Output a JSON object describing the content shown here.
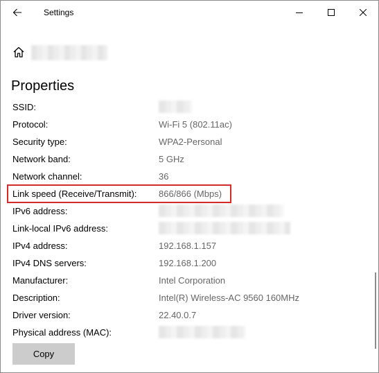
{
  "window": {
    "title": "Settings"
  },
  "page": {
    "heading": "Properties"
  },
  "properties": [
    {
      "label": "SSID:",
      "value": null
    },
    {
      "label": "Protocol:",
      "value": "Wi-Fi 5 (802.11ac)"
    },
    {
      "label": "Security type:",
      "value": "WPA2-Personal"
    },
    {
      "label": "Network band:",
      "value": "5 GHz"
    },
    {
      "label": "Network channel:",
      "value": "36"
    },
    {
      "label": "Link speed (Receive/Transmit):",
      "value": "866/866 (Mbps)"
    },
    {
      "label": "IPv6 address:",
      "value": null
    },
    {
      "label": "Link-local IPv6 address:",
      "value": null
    },
    {
      "label": "IPv4 address:",
      "value": "192.168.1.157"
    },
    {
      "label": "IPv4 DNS servers:",
      "value": "192.168.1.200"
    },
    {
      "label": "Manufacturer:",
      "value": "Intel Corporation"
    },
    {
      "label": "Description:",
      "value": "Intel(R) Wireless-AC 9560 160MHz"
    },
    {
      "label": "Driver version:",
      "value": "22.40.0.7"
    },
    {
      "label": "Physical address (MAC):",
      "value": null
    }
  ],
  "actions": {
    "copy_label": "Copy"
  },
  "colors": {
    "highlight_border": "#d42a2a",
    "button_bg": "#cccccc",
    "value_text": "#666666"
  },
  "icons": [
    "back-arrow-icon",
    "minimize-icon",
    "maximize-icon",
    "close-icon",
    "home-icon"
  ]
}
